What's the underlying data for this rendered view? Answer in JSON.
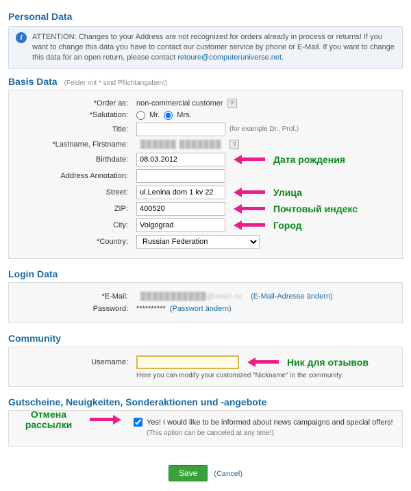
{
  "personal_data": {
    "title": "Personal Data",
    "attention": "ATTENTION: Changes to your Address are not recognized for orders already in process or returns! If you want to change this data you have to contact our customer service by phone or E-Mail. If you want to change this data for an open return, please contact ",
    "return_email": "retoure@computeruniverse.net"
  },
  "basis": {
    "title": "Basis Data",
    "subtitle": "(Felder mit * sind Pflichtangaben!)",
    "order_as_label": "*Order as:",
    "order_as_value": "non-commercial customer",
    "salutation_label": "*Salutation:",
    "mr": "Mr.",
    "mrs": "Mrs.",
    "title_label": "Title:",
    "title_hint": "(for example Dr., Prof.)",
    "lastname_label": "*Lastname, Firstname:",
    "lastname_value": "██████  ███████",
    "birthdate_label": "Birthdate:",
    "birthdate_value": "08.03.2012",
    "birthdate_anno": "Дата рождения",
    "address_anno_label": "Address Annotation:",
    "street_label": "Street:",
    "street_value": "ul.Lenina dom 1 kv 22",
    "street_anno": "Улица",
    "zip_label": "ZIP:",
    "zip_value": "400520",
    "zip_anno": "Почтовый индекс",
    "city_label": "City:",
    "city_value": "Volgograd",
    "city_anno": "Город",
    "country_label": "*Country:",
    "country_value": "Russian Federation"
  },
  "login": {
    "title": "Login Data",
    "email_label": "*E-Mail:",
    "email_value": "███████████@mail.ru",
    "email_change": "(E-Mail-Adresse ändern)",
    "password_label": "Password:",
    "password_value": "**********",
    "password_change": "(Passwort ändern)"
  },
  "community": {
    "title": "Community",
    "username_label": "Username:",
    "username_anno": "Ник для отзывов",
    "hint": "Here you can modify your customized \"Nickname\" in the community."
  },
  "newsletter": {
    "title": "Gutscheine, Neuigkeiten, Sonderaktionen und -angebote",
    "anno_line1": "Отмена",
    "anno_line2": "рассылки",
    "label": "Yes! I would like to be informed about news campaigns and special offers! ",
    "note": "(This option can be canceled at any time!)"
  },
  "footer": {
    "save": "Save",
    "cancel": "(Cancel)"
  }
}
